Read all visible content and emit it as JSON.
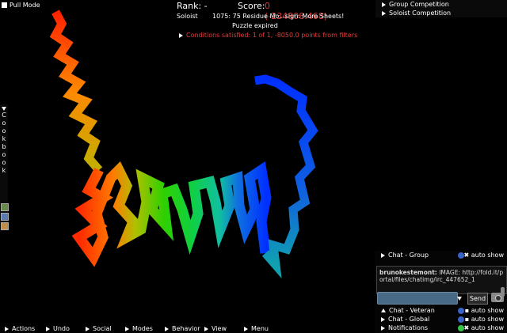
{
  "pull_mode": {
    "label": "Pull Mode"
  },
  "score_panel": {
    "rank": "Rank: -",
    "score_label": "Score:",
    "score_value": "0 (-234808.468)",
    "mode": "Soloist",
    "puzzle_name": "1075: 75 Residue Mo...sign: More Sheets!",
    "status": "Puzzle expired",
    "conditions": "Conditions satisfied: 1 of 1, -8050.0 points from filters"
  },
  "competitions": {
    "group": "Group Competition",
    "soloist": "Soloist Competition"
  },
  "cookbook": {
    "letters": [
      "C",
      "o",
      "o",
      "k",
      "b",
      "o",
      "o",
      "k"
    ]
  },
  "bottom_menu": {
    "actions": "Actions",
    "undo": "Undo",
    "social": "Social",
    "modes": "Modes",
    "behavior": "Behavior",
    "view": "View",
    "menu": "Menu"
  },
  "chat": {
    "group_tab": "Chat - Group",
    "auto_show": "auto show",
    "message_user": "brunokestemont:",
    "message_text": " IMAGE: http://fold.it/portal/files/chatimg/irc_447652_1",
    "send_label": "Send",
    "veteran_tab": "Chat - Veteran",
    "global_tab": "Chat - Global",
    "notifications_tab": "Notifications"
  },
  "colors": {
    "accent_red": "#e23b3b",
    "badge_blue": "#3a63c8",
    "badge_green": "#35c44a"
  }
}
